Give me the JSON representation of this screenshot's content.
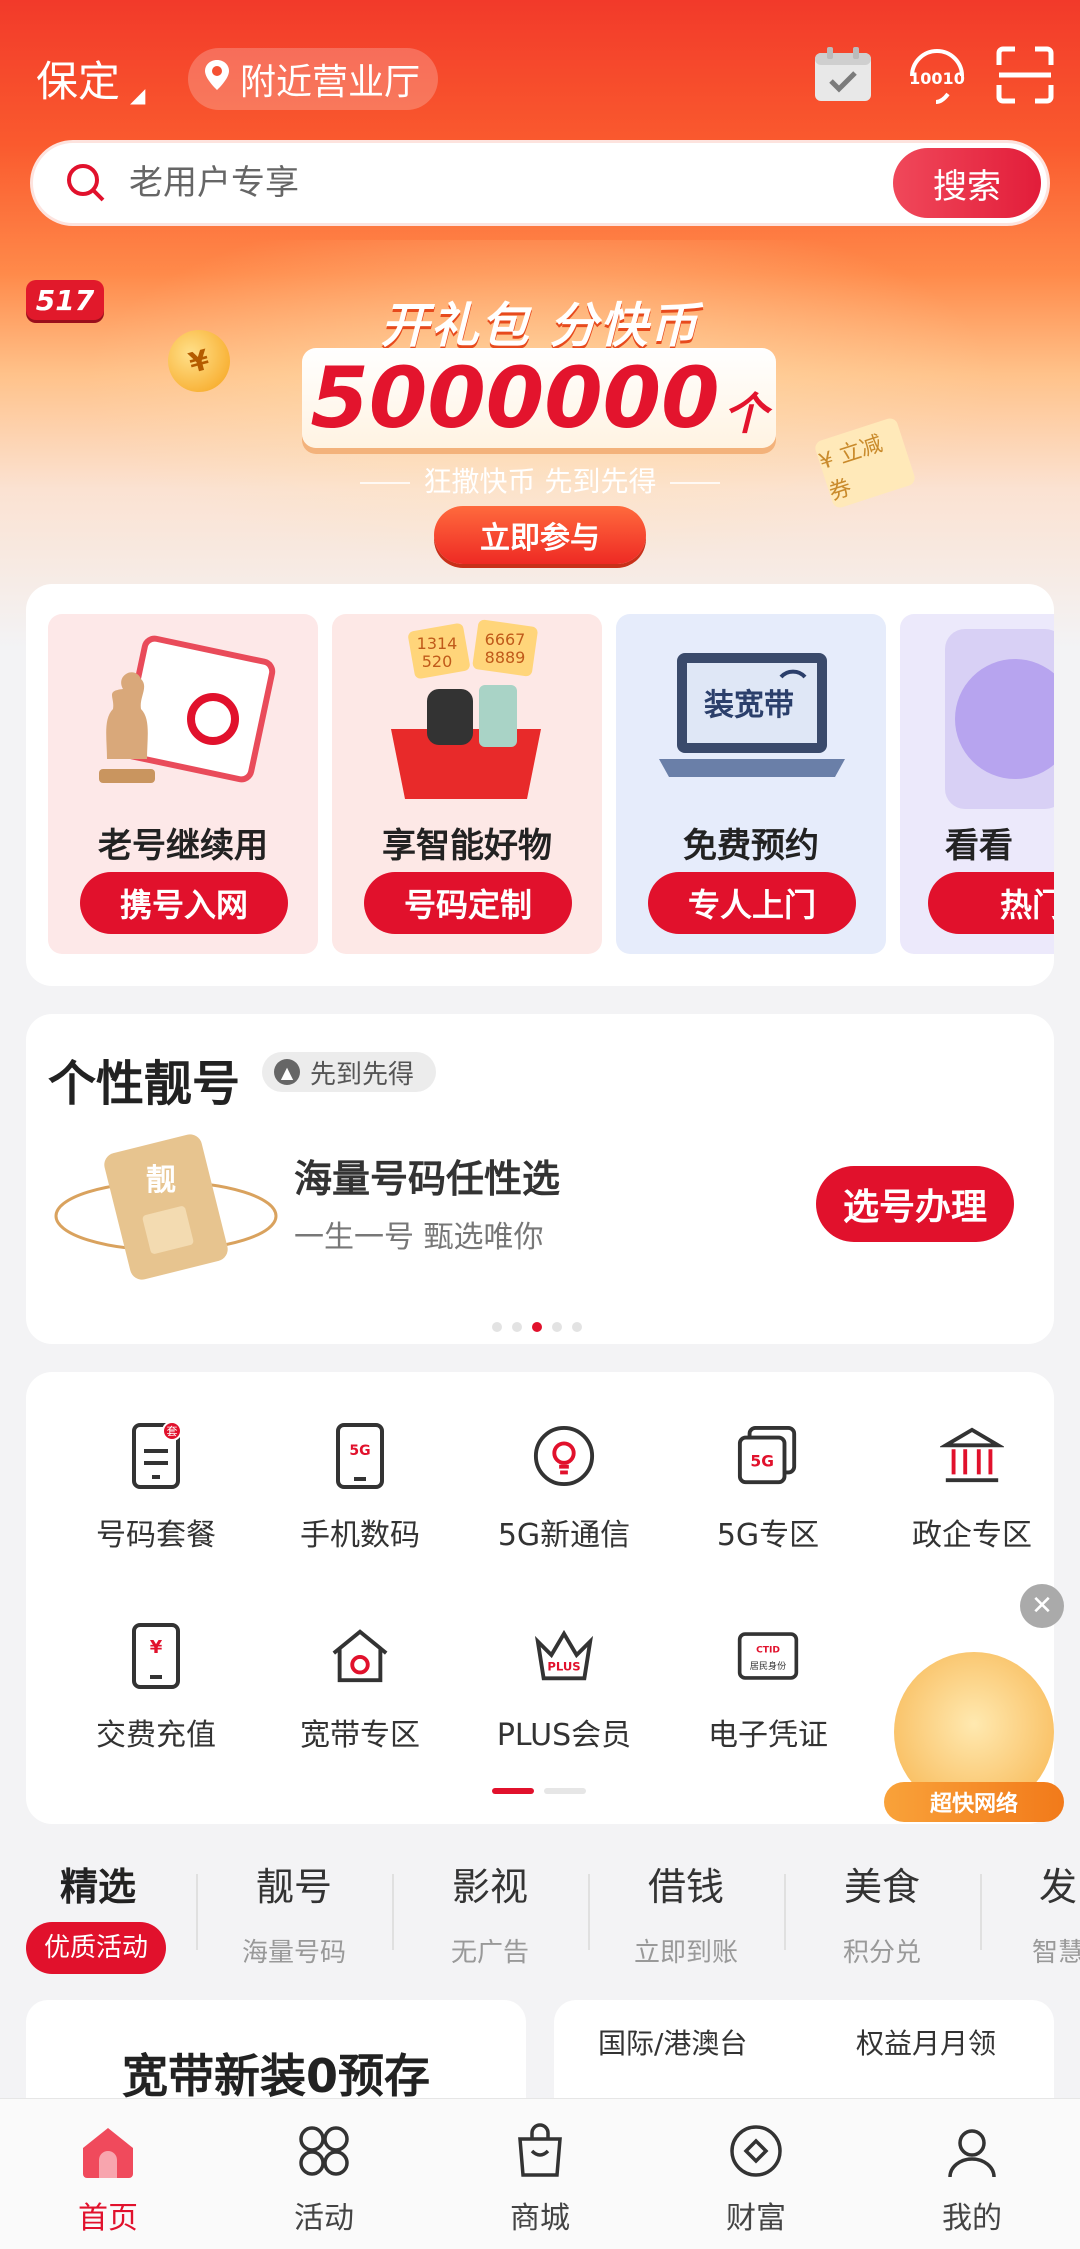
{
  "header": {
    "city": "保定",
    "nearby_label": "附近营业厅",
    "search_placeholder": "老用户专享",
    "search_button": "搜索"
  },
  "banner": {
    "badge": "517",
    "title": "开礼包 分快币",
    "amount": "5000000",
    "amount_unit": "个",
    "subtitle": "狂撒快币 先到先得",
    "cta": "立即参与",
    "ticket_text": "¥ 立减券"
  },
  "promo_cards": [
    {
      "title": "老号继续用",
      "button": "携号入网",
      "bg": "#fde8e8"
    },
    {
      "title": "享智能好物",
      "button": "号码定制",
      "bg": "#fde8e6",
      "ill_text": [
        "1314",
        "520",
        "6667",
        "8889"
      ]
    },
    {
      "title": "免费预约",
      "button": "专人上门",
      "bg": "#e6ecfb",
      "ill_text": "装宽带"
    },
    {
      "title": "看看",
      "button": "热门",
      "bg": "#ece9fb"
    }
  ],
  "number_card": {
    "heading": "个性靓号",
    "tag": "先到先得",
    "line1": "海量号码任性选",
    "line2": "一生一号 甄选唯你",
    "button": "选号办理",
    "sim_text": "靓",
    "dots": 5,
    "active_dot": 2
  },
  "services": [
    {
      "label": "号码套餐",
      "icon": "phone-plan-icon"
    },
    {
      "label": "手机数码",
      "icon": "phone-5g-icon"
    },
    {
      "label": "5G新通信",
      "icon": "bulb-icon"
    },
    {
      "label": "5G专区",
      "icon": "5g-zone-icon"
    },
    {
      "label": "政企专区",
      "icon": "bank-icon"
    },
    {
      "label": "交费充值",
      "icon": "recharge-icon"
    },
    {
      "label": "宽带专区",
      "icon": "broadband-house-icon"
    },
    {
      "label": "PLUS会员",
      "icon": "crown-icon"
    },
    {
      "label": "电子凭证",
      "icon": "id-card-icon"
    }
  ],
  "floating_ad": {
    "label": "超快网络"
  },
  "categories": [
    {
      "title": "精选",
      "sub": "优质活动",
      "active": true
    },
    {
      "title": "靓号",
      "sub": "海量号码"
    },
    {
      "title": "影视",
      "sub": "无广告"
    },
    {
      "title": "借钱",
      "sub": "立即到账"
    },
    {
      "title": "美食",
      "sub": "积分兑"
    },
    {
      "title": "发",
      "sub": "智慧"
    }
  ],
  "feed": {
    "left_title": "宽带新装0预存",
    "right_a": "国际/港澳台",
    "right_b": "权益月月领"
  },
  "nav": [
    {
      "label": "首页",
      "icon": "home-icon",
      "active": true
    },
    {
      "label": "活动",
      "icon": "activity-icon"
    },
    {
      "label": "商城",
      "icon": "shop-bag-icon"
    },
    {
      "label": "财富",
      "icon": "wealth-icon"
    },
    {
      "label": "我的",
      "icon": "profile-icon"
    }
  ],
  "colors": {
    "brand_red": "#e1112c",
    "accent_orange": "#fa5a2e"
  }
}
